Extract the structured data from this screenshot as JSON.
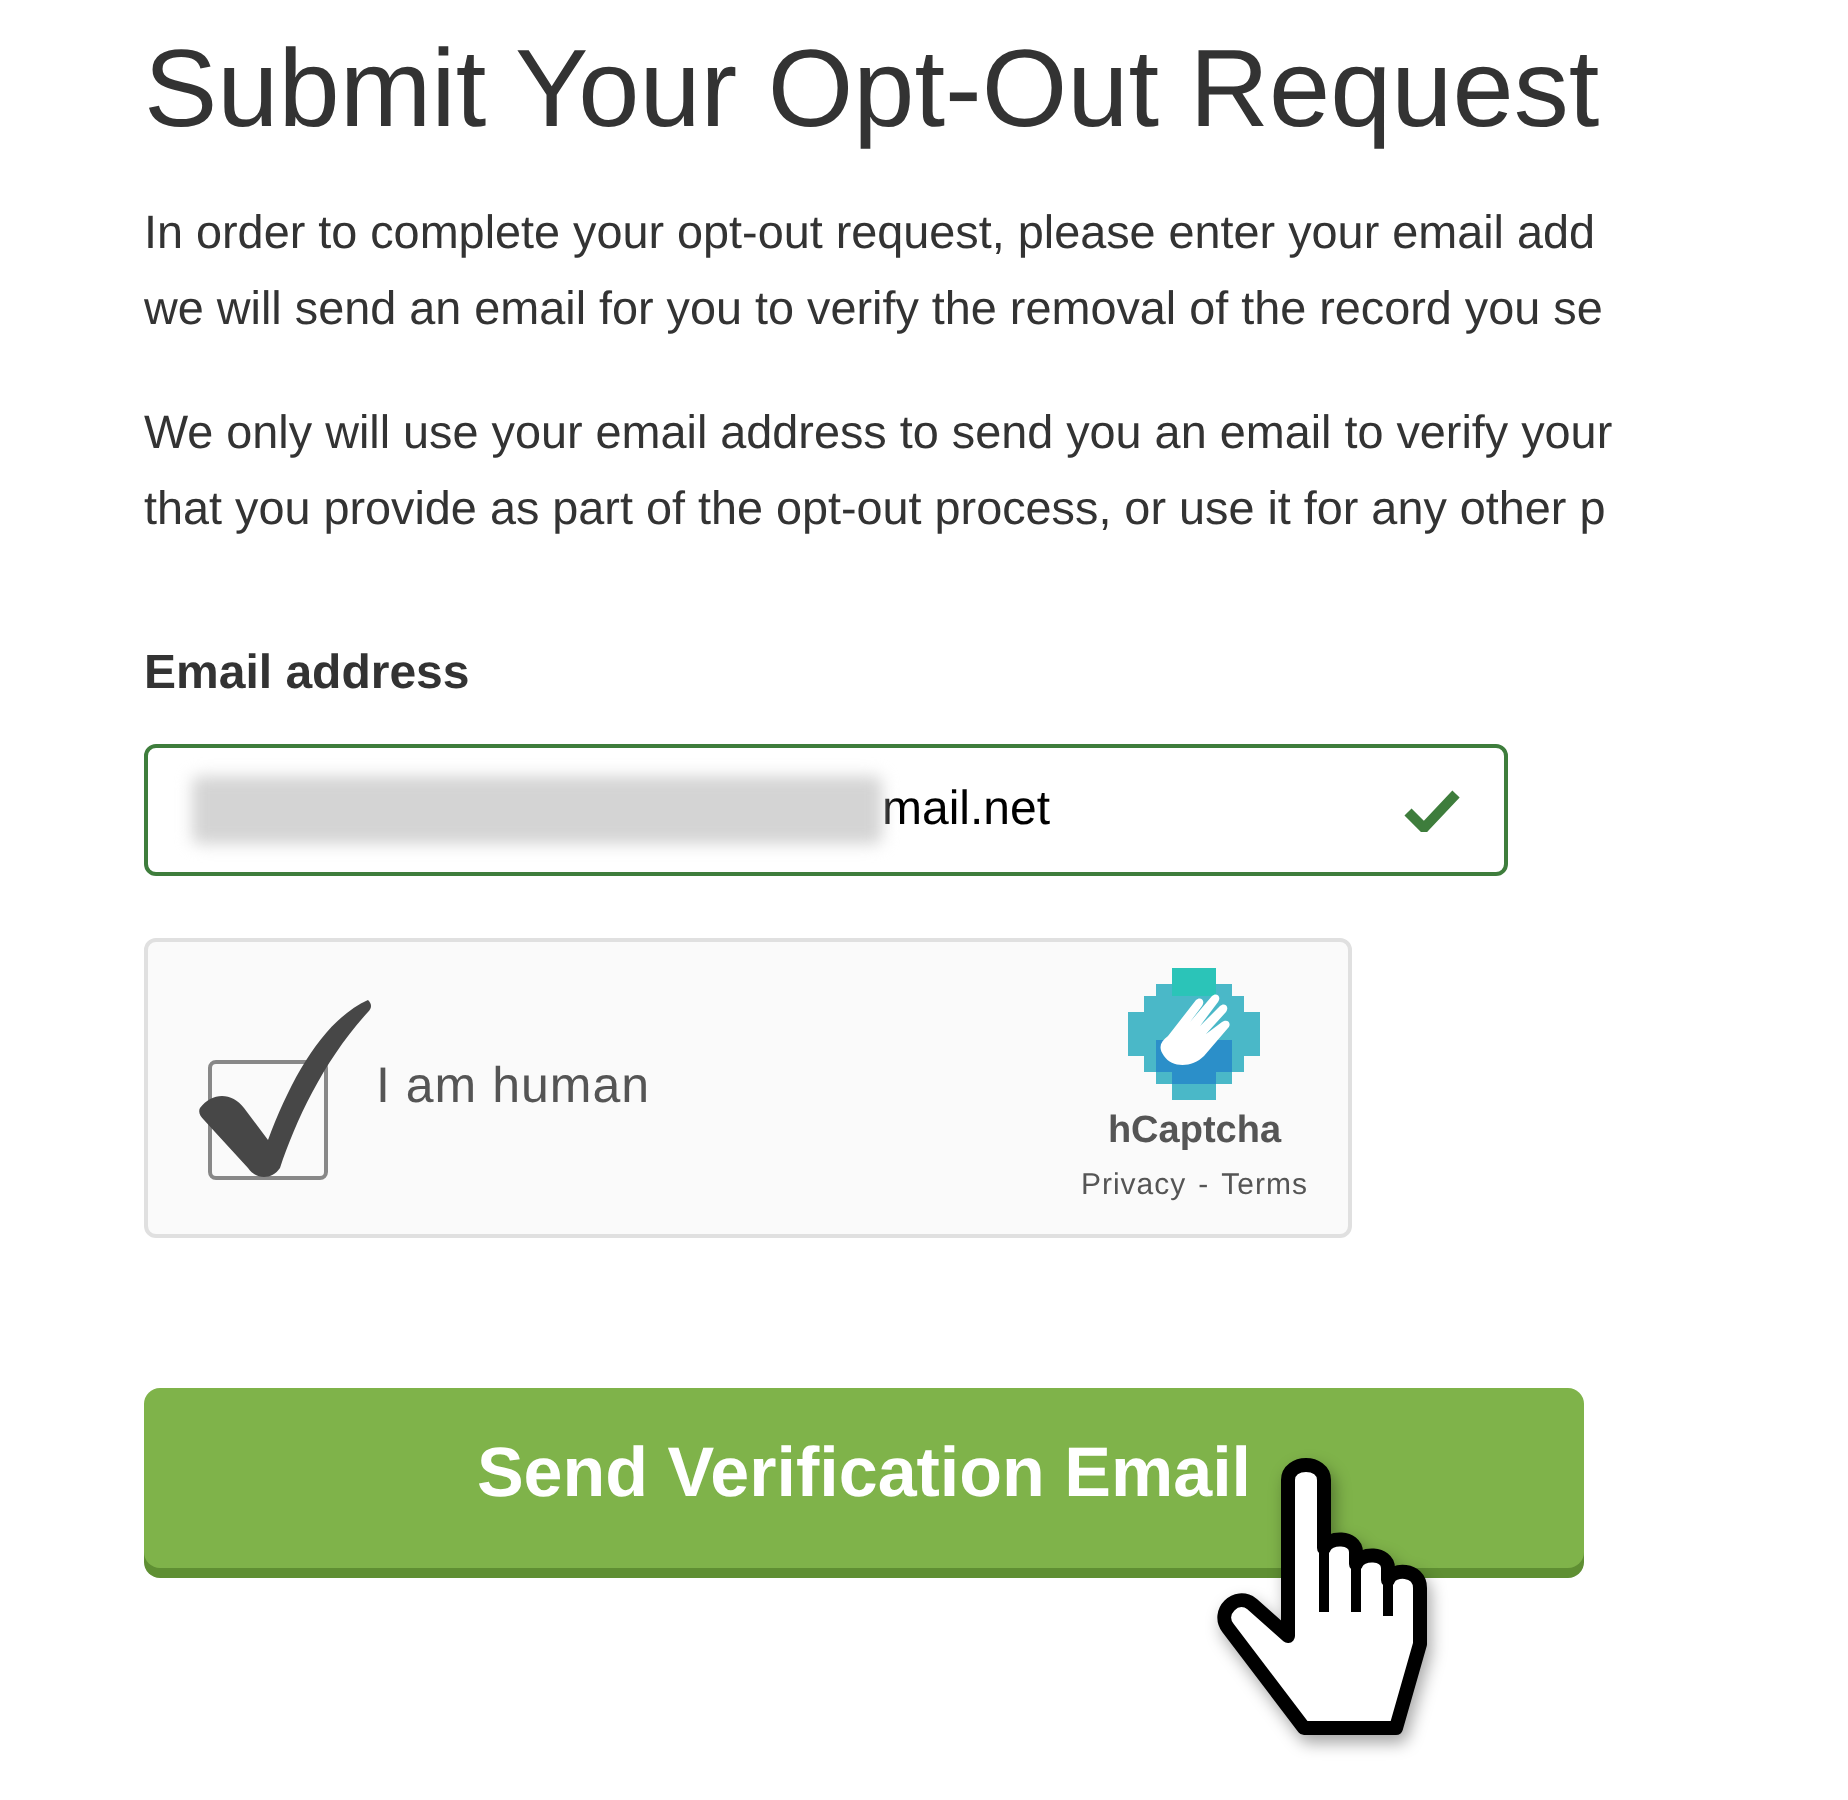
{
  "heading": "Submit Your Opt-Out Request",
  "paragraphs": [
    {
      "lines": [
        "In order to complete your opt-out request, please enter your email add",
        "we will send an email for you to verify the removal of the record you se"
      ]
    },
    {
      "lines": [
        "We only will use your email address to send you an email to verify your",
        "that you provide as part of the opt-out process, or use it for any other p"
      ]
    }
  ],
  "email_field": {
    "label": "Email address",
    "value": "mail.net",
    "valid": true
  },
  "captcha": {
    "label": "I am human",
    "checked": true,
    "brand": "hCaptcha",
    "links": [
      "Privacy",
      "-",
      "Terms"
    ]
  },
  "submit_button": {
    "label": "Send Verification Email"
  }
}
